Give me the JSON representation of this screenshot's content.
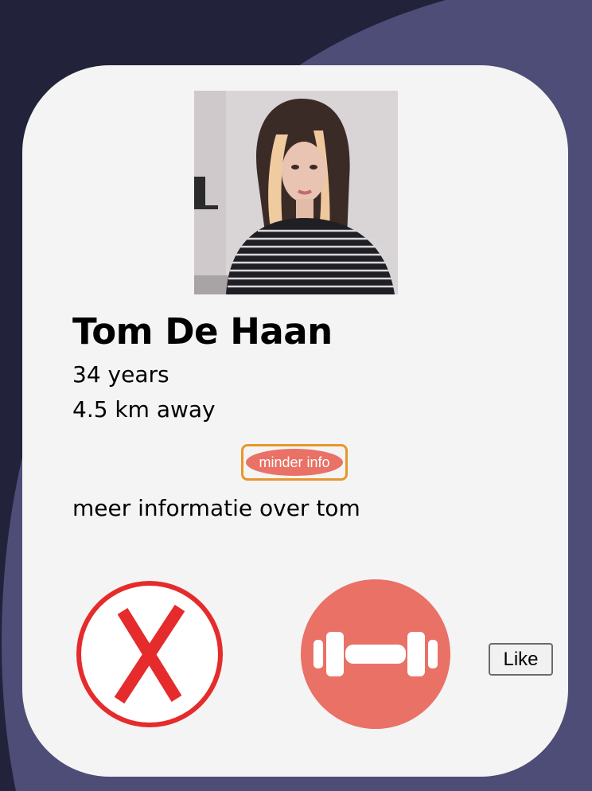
{
  "colors": {
    "background_dark": "#22223a",
    "background_wave": "#4d4d78",
    "card": "#f4f4f4",
    "accent_coral": "#e97166",
    "button_border_orange": "#e8962c",
    "dislike_red": "#e52b2b"
  },
  "profile": {
    "name": "Tom De Haan",
    "age": "34 years",
    "distance": "4.5 km away",
    "description": "meer informatie over tom"
  },
  "actions": {
    "info_toggle_label": "minder info",
    "dislike_icon": "x-circle-icon",
    "interest_icon": "dumbbell-icon",
    "like_label": "Like"
  }
}
